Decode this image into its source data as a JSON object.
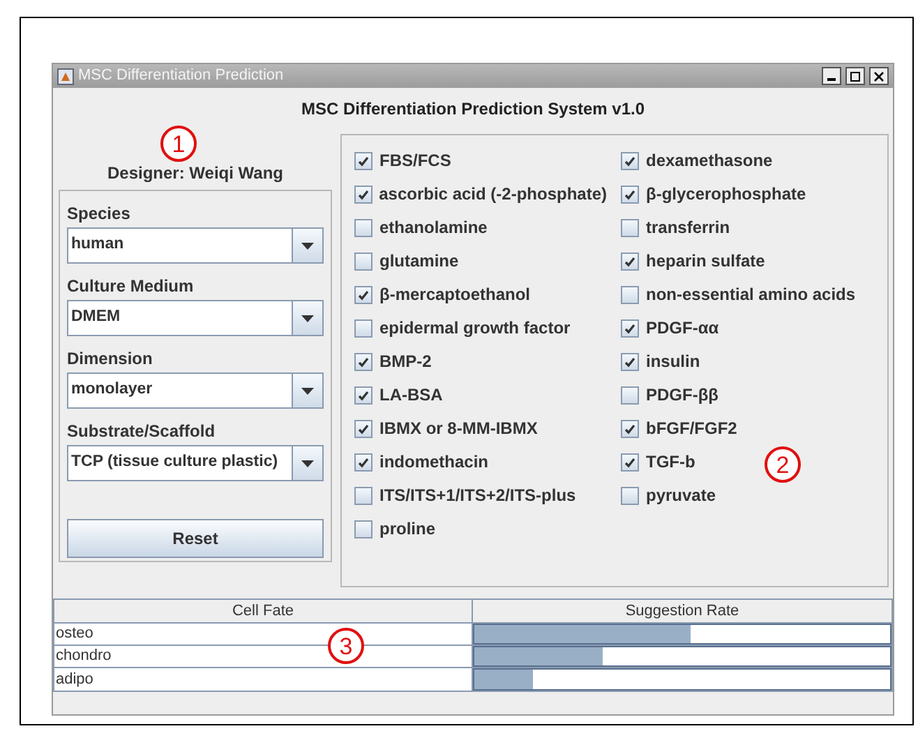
{
  "window": {
    "title": "MSC Differentiation Prediction"
  },
  "heading": "MSC Differentiation Prediction System v1.0",
  "designer": "Designer: Weiqi Wang",
  "fields": [
    {
      "label": "Species",
      "value": "human"
    },
    {
      "label": "Culture Medium",
      "value": "DMEM"
    },
    {
      "label": "Dimension",
      "value": "monolayer"
    },
    {
      "label": "Substrate/Scaffold",
      "value": "TCP (tissue culture plastic)"
    }
  ],
  "reset_button": "Reset",
  "supplement_columns": [
    [
      {
        "label": "FBS/FCS",
        "checked": true
      },
      {
        "label": "ascorbic acid (-2-phosphate)",
        "checked": true
      },
      {
        "label": "ethanolamine",
        "checked": false
      },
      {
        "label": "glutamine",
        "checked": false
      },
      {
        "label": "β-mercaptoethanol",
        "checked": true
      },
      {
        "label": "epidermal growth factor",
        "checked": false
      },
      {
        "label": "BMP-2",
        "checked": true
      },
      {
        "label": "LA-BSA",
        "checked": true
      },
      {
        "label": "IBMX or 8-MM-IBMX",
        "checked": true
      },
      {
        "label": "indomethacin",
        "checked": true
      },
      {
        "label": "ITS/ITS+1/ITS+2/ITS-plus",
        "checked": false
      },
      {
        "label": "proline",
        "checked": false
      }
    ],
    [
      {
        "label": "dexamethasone",
        "checked": true
      },
      {
        "label": "β-glycerophosphate",
        "checked": true
      },
      {
        "label": "transferrin",
        "checked": false
      },
      {
        "label": "heparin sulfate",
        "checked": true
      },
      {
        "label": "non-essential amino acids",
        "checked": false
      },
      {
        "label": "PDGF-αα",
        "checked": true
      },
      {
        "label": "insulin",
        "checked": true
      },
      {
        "label": "PDGF-ββ",
        "checked": false
      },
      {
        "label": "bFGF/FGF2",
        "checked": true
      },
      {
        "label": "TGF-b",
        "checked": true
      },
      {
        "label": "pyruvate",
        "checked": false
      }
    ]
  ],
  "table": {
    "columns": [
      "Cell Fate",
      "Suggestion Rate"
    ],
    "rows": [
      {
        "fate": "osteo",
        "level": 0.52
      },
      {
        "fate": "chondro",
        "level": 0.31
      },
      {
        "fate": "adipo",
        "level": 0.14
      }
    ]
  },
  "annotations": [
    "1",
    "2",
    "3"
  ]
}
